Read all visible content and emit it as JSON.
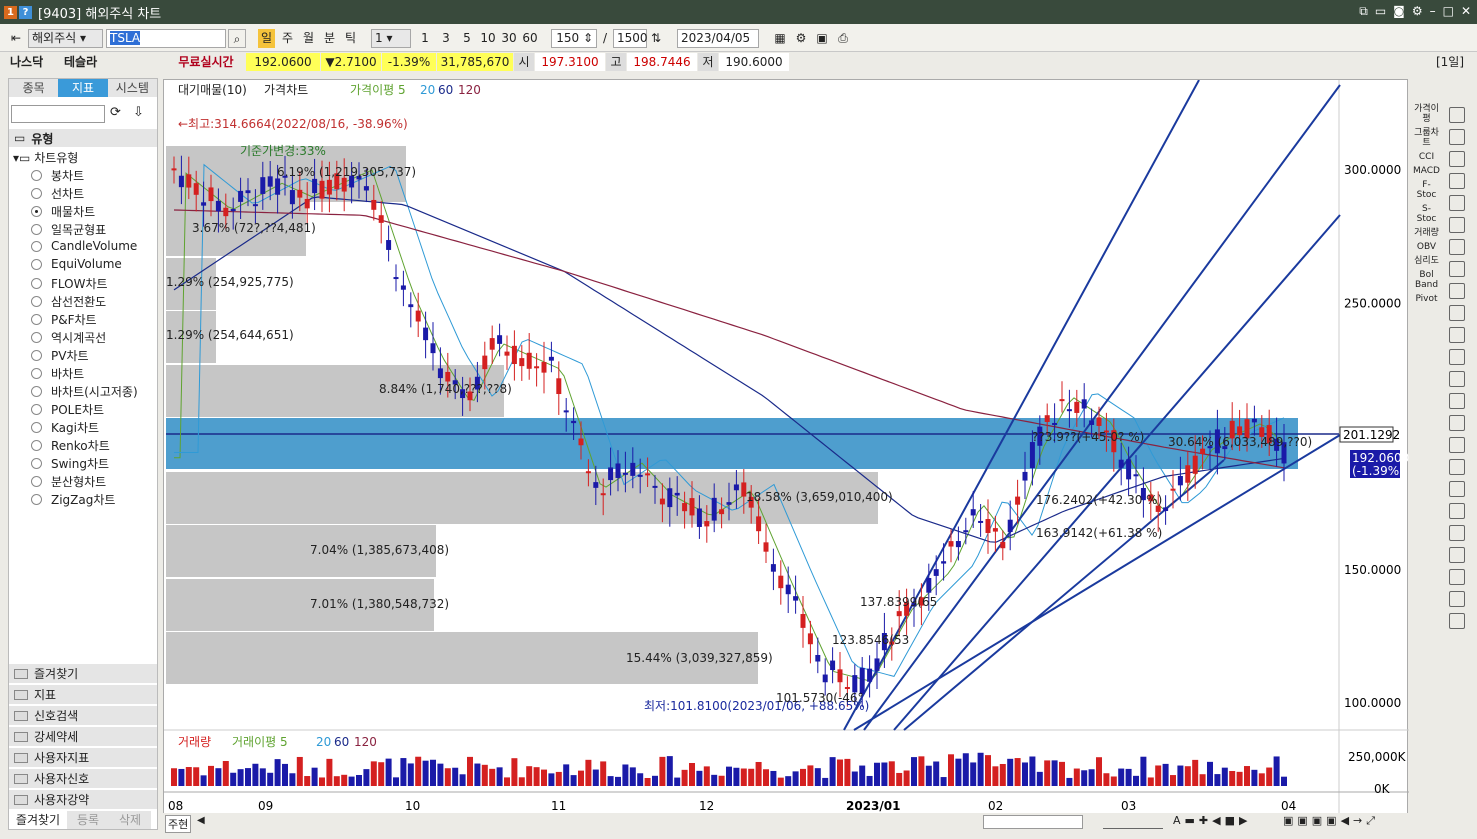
{
  "window": {
    "title": "[9403] 해외주식 차트",
    "num_icon": "1",
    "help_icon": "?"
  },
  "toolbar": {
    "market": "해외주식",
    "symbol": "TSLA",
    "period_active": "일",
    "period_w": "주",
    "period_m": "월",
    "period_q": "분",
    "period_t": "틱",
    "interval": "1",
    "n1": "1",
    "n3": "3",
    "n5": "5",
    "n10": "10",
    "n30": "30",
    "n60": "60",
    "count": "150",
    "slash": "/",
    "total": "1500",
    "date": "2023/04/05"
  },
  "quote": {
    "exchange": "나스닥",
    "name": "테슬라",
    "realtime": "무료실시간",
    "price": "192.0600",
    "change": "▼2.7100",
    "pct": "-1.39%",
    "volume": "31,785,670",
    "open_lbl": "시",
    "open": "197.3100",
    "high_lbl": "고",
    "high": "198.7446",
    "low_lbl": "저",
    "low": "190.6000",
    "tf": "[1일]"
  },
  "left": {
    "tabs": [
      "종목",
      "지표",
      "시스템"
    ],
    "section": "유형",
    "tree": "차트유형",
    "types": [
      "봉차트",
      "선차트",
      "매물차트",
      "일목균형표",
      "CandleVolume",
      "EquiVolume",
      "FLOW차트",
      "삼선전환도",
      "P&F차트",
      "역시계곡선",
      "PV차트",
      "바차트",
      "바차트(시고저종)",
      "POLE차트",
      "Kagi차트",
      "Renko차트",
      "Swing차트",
      "분산형차트",
      "ZigZag차트"
    ],
    "selected": 2,
    "folders": [
      "즐겨찾기",
      "지표",
      "신호검색",
      "강세약세",
      "사용자지표",
      "사용자신호",
      "사용자강약"
    ],
    "bottom": [
      "즐겨찾기",
      "등록",
      "삭제"
    ]
  },
  "chart": {
    "legend_top": [
      "대기매물(10)",
      "가격차트",
      "가격이평 5",
      "20",
      "60",
      "120"
    ],
    "legend_bottom": [
      "거래량",
      "거래이평 5",
      "20",
      "60",
      "120"
    ],
    "high_label": "←최고:314.6664(2022/08/16, -38.96%)",
    "low_label": "최저:101.8100(2023/01/06, +88.65%)",
    "ref_label": "기준가변경:33%",
    "y_ticks": [
      "300.0000",
      "250.0000",
      "150.0000",
      "100.0000"
    ],
    "vol_ticks": [
      "250,000K",
      "0K"
    ],
    "x_ticks": [
      "08",
      "09",
      "10",
      "11",
      "12",
      "2023/01",
      "02",
      "03",
      "04"
    ],
    "price_tag": "192.0600",
    "price_tag2": "(-1.39%)",
    "line_tag": "201.1292",
    "vp_labels": [
      "6.19% (1,219,305,737)",
      "3.67% (72?,??4,481)",
      "1.29% (254,925,775)",
      "1.29% (254,644,651)",
      "8.84% (1,740,???,??8)",
      "30.64% (6,033,489,??0)",
      "18.58% (3,659,010,400)",
      "7.04% (1,385,673,408)",
      "7.01% (1,380,548,732)",
      "15.44% (3,039,327,859)"
    ],
    "annots": [
      "??3.9??(+45.0? %)",
      "176.2402(+42.30 %)",
      "163.9142(+61.38 %)",
      "137.8399(65",
      "123.8546(53",
      "101.5730(-46°"
    ],
    "colors": {
      "up": "#d42020",
      "down": "#1a1aa8",
      "band": "#3b93c9",
      "ma5": "#5fa330",
      "ma20": "#2f9ad6",
      "ma60": "#1a2a8a",
      "ma120": "#8a2240"
    }
  },
  "right_tools": [
    "가격이평",
    "그룹차트",
    "CCI",
    "MACD",
    "F-Stoc",
    "S-Stoc",
    "거래량",
    "OBV",
    "심리도",
    "Bol Band",
    "Pivot"
  ],
  "bottom": {
    "zoom": "주현"
  }
}
